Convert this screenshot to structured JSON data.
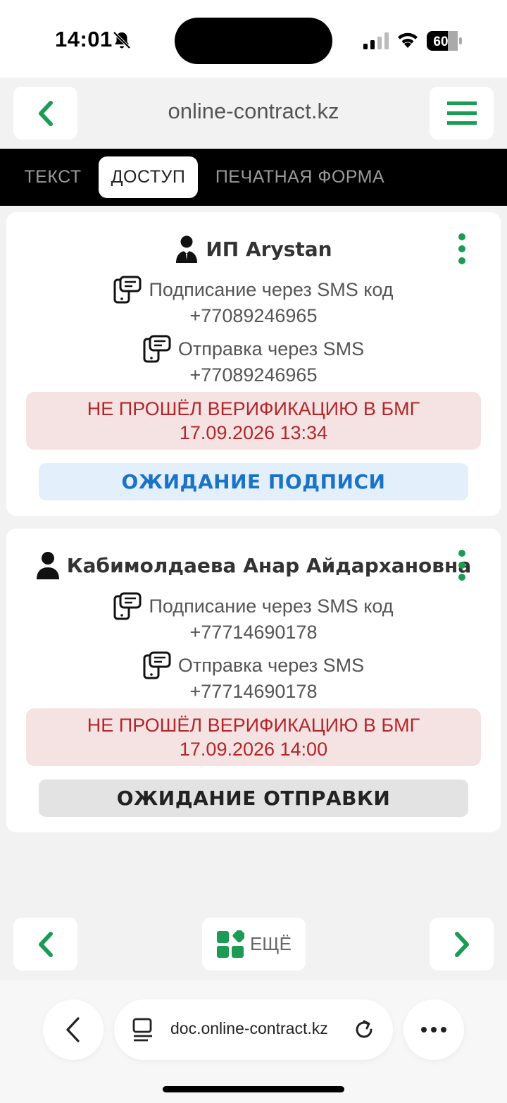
{
  "status_bar": {
    "time": "14:01",
    "battery": "60",
    "icons": [
      "bell-slash-icon",
      "cellular-signal-icon",
      "wifi-icon",
      "battery-icon"
    ]
  },
  "header": {
    "title": "online-contract.kz",
    "back_icon": "chevron-left-icon",
    "menu_icon": "hamburger-menu-icon"
  },
  "tabs": [
    {
      "label": "ТЕКСТ",
      "active": false
    },
    {
      "label": "ДОСТУП",
      "active": true
    },
    {
      "label": "ПЕЧАТНАЯ ФОРМА",
      "active": false
    }
  ],
  "parties": [
    {
      "name": "ИП Arystan",
      "icon": "businessman-icon",
      "sign_method": "Подписание через SMS код",
      "sign_phone": "+77089246965",
      "send_method": "Отправка через SMS",
      "send_phone": "+77089246965",
      "alert_line1": "НЕ ПРОШЁЛ ВЕРИФИКАЦИЮ В БМГ",
      "alert_line2": "17.09.2026 13:34",
      "status": "ОЖИДАНИЕ ПОДПИСИ"
    },
    {
      "name": "Кабимолдаева Анар Айдархановна",
      "icon": "person-icon",
      "sign_method": "Подписание через SMS код",
      "sign_phone": "+77714690178",
      "send_method": "Отправка через SMS",
      "send_phone": "+77714690178",
      "alert_line1": "НЕ ПРОШЁЛ ВЕРИФИКАЦИЮ В БМГ",
      "alert_line2": "17.09.2026 14:00",
      "status": "ОЖИДАНИЕ ОТПРАВКИ"
    }
  ],
  "pager": {
    "more_label": "ЕЩЁ"
  },
  "browser": {
    "url": "doc.online-contract.kz"
  },
  "colors": {
    "accent_green": "#1c9b54",
    "alert_red": "#b3262a",
    "alert_bg": "#f5e3e3",
    "status_blue": "#1a73c8"
  }
}
